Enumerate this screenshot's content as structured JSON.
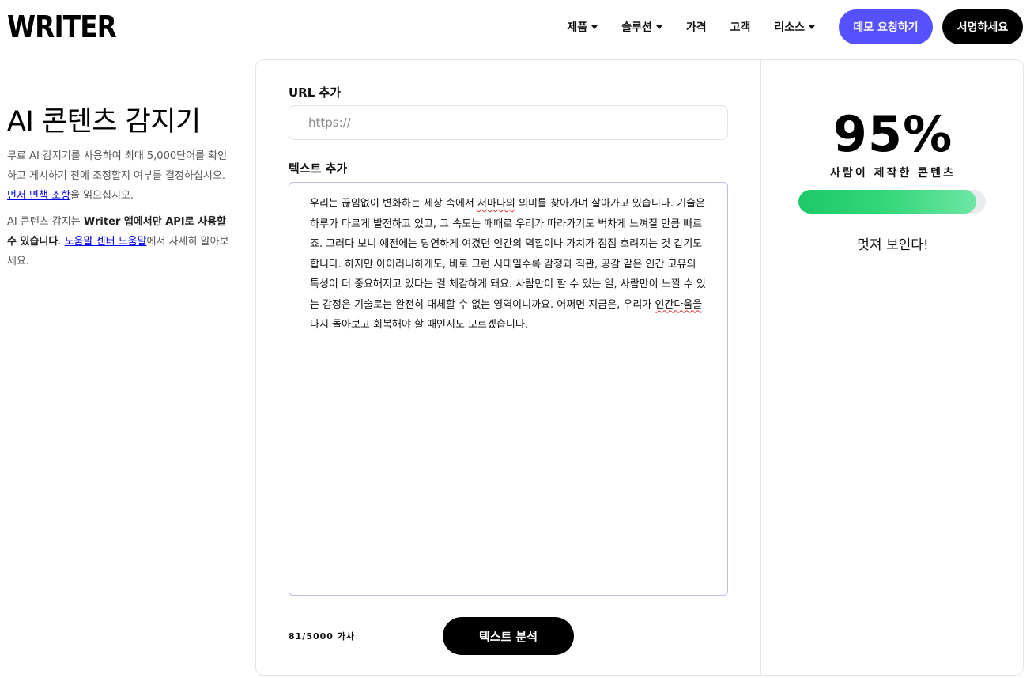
{
  "header": {
    "logo": "WRITER",
    "nav": [
      {
        "label": "제품",
        "dropdown": true
      },
      {
        "label": "솔루션",
        "dropdown": true
      },
      {
        "label": "가격",
        "dropdown": false
      },
      {
        "label": "고객",
        "dropdown": false
      },
      {
        "label": "리소스",
        "dropdown": true
      }
    ],
    "demo_button": "데모 요청하기",
    "signup_button": "서명하세요",
    "colors": {
      "demo": "#5551ff",
      "signup": "#000000"
    }
  },
  "intro": {
    "title": "AI 콘텐츠 감지기",
    "desc1_before": "무료 AI 감지기를 사용하여 최대 5,000단어를 확인하고 게시하기 전에 조정할지 여부를 결정하십시오. ",
    "desc1_link": "먼저 면책 조항",
    "desc1_after": "을 읽으십시오.",
    "desc2_before": "AI 콘텐츠 감지는 ",
    "desc2_bold": "Writer 앱에서만 API로 사용할 수 있습니다",
    "desc2_mid": ". ",
    "desc2_link": "도움말 센터 도움말",
    "desc2_after": "에서 자세히 알아보세요."
  },
  "form": {
    "url_label": "URL 추가",
    "url_placeholder": "https://",
    "url_value": "",
    "text_label": "텍스트 추가",
    "text_parts": [
      {
        "t": "우리는 끊임없이 변화하는 세상 속에서 ",
        "sq": false
      },
      {
        "t": "저마다의",
        "sq": true
      },
      {
        "t": " 의미를 찾아가며 살아가고 있습니다. 기술은 하루가 다르게 발전하고 있고, 그 속도는 때때로 우리가 따라가기도 벅차게 느껴질 만큼 빠르죠. 그러다 보니 예전에는 당연하게 여겼던 인간의 역할이나 가치가 점점 흐려지는 것 같기도 합니다. 하지만 아이러니하게도, 바로 그런 시대일수록 감정과 직관, 공감 같은 인간 고유의 특성이 더 중요해지고 있다는 걸 체감하게 돼요. 사람만이 할 수 있는 일, 사람만이 느낄 수 있는 감정은 기술로는 완전히 대체할 수 없는 영역이니까요. 어쩌면 지금은, 우리가 ",
        "sq": false
      },
      {
        "t": "인간다움을",
        "sq": true
      },
      {
        "t": " 다시 돌아보고 회복해야 할 때인지도 모르겠습니다.",
        "sq": false
      }
    ],
    "word_count": "81/5000 가사",
    "analyze_button": "텍스트 분석"
  },
  "result": {
    "score": "95%",
    "score_fraction": 0.95,
    "label": "사람이 제작한 콘텐츠",
    "verdict": "멋져 보인다!",
    "bar_color": "#1dc968"
  }
}
